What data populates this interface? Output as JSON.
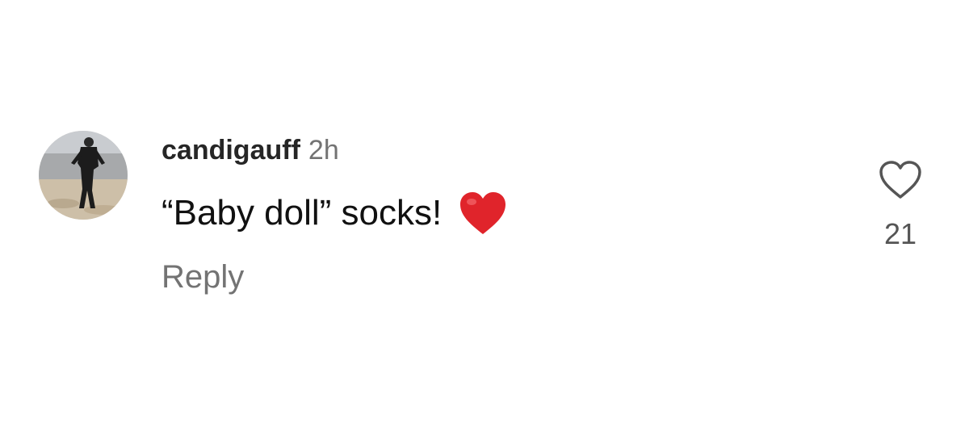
{
  "comment": {
    "username": "candigauff",
    "timestamp": "2h",
    "text": "“Baby doll” socks!",
    "emoji": "red-heart-emoji",
    "reply_label": "Reply",
    "like_count": "21",
    "like_icon": "heart-outline-icon"
  },
  "colors": {
    "username": "#262626",
    "secondary_text": "#737373",
    "heart_emoji": "#e0242b",
    "background": "#ffffff"
  }
}
